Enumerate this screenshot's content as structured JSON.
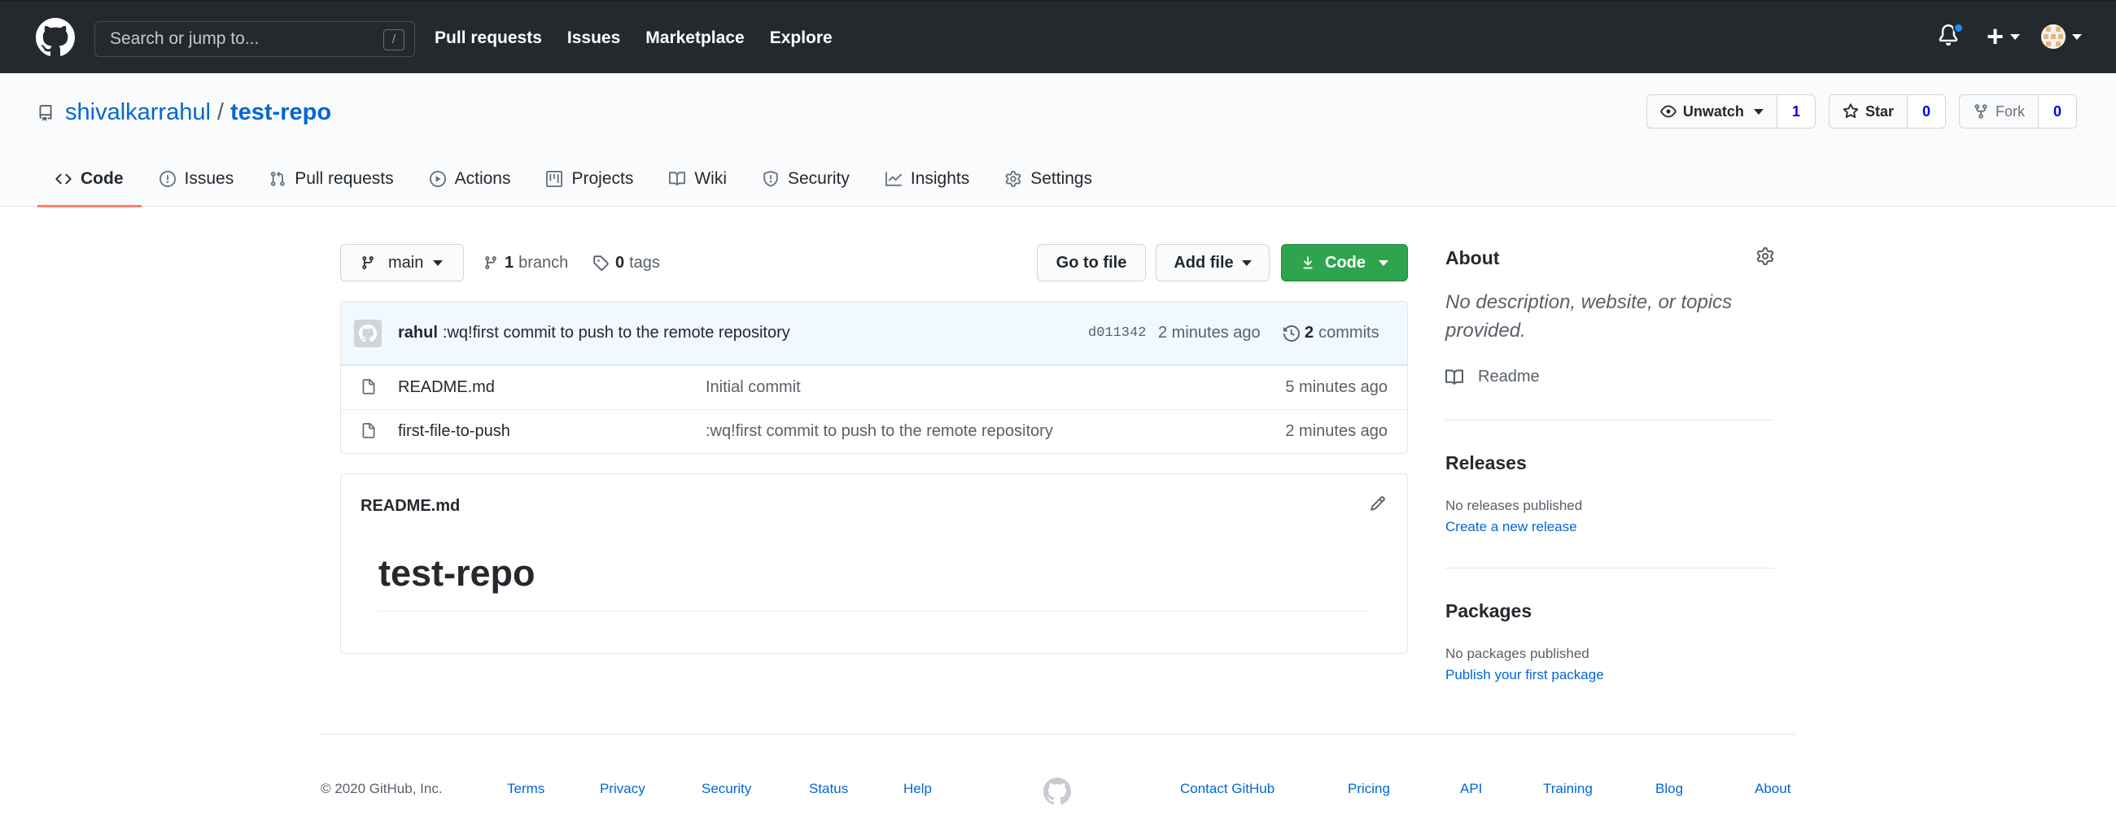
{
  "header": {
    "search_placeholder": "Search or jump to...",
    "search_shortcut": "/",
    "nav": [
      "Pull requests",
      "Issues",
      "Marketplace",
      "Explore"
    ],
    "plus_label": "+",
    "notification_dot_color": "#2188ff"
  },
  "repo": {
    "owner": "shivalkarrahul",
    "separator": "/",
    "name": "test-repo",
    "watch": {
      "label": "Unwatch",
      "count": "1"
    },
    "star": {
      "label": "Star",
      "count": "0"
    },
    "fork": {
      "label": "Fork",
      "count": "0"
    }
  },
  "tabs": [
    {
      "label": "Code",
      "icon": "code-icon",
      "selected": true
    },
    {
      "label": "Issues",
      "icon": "issue-opened-icon"
    },
    {
      "label": "Pull requests",
      "icon": "git-pull-request-icon"
    },
    {
      "label": "Actions",
      "icon": "play-icon"
    },
    {
      "label": "Projects",
      "icon": "project-icon"
    },
    {
      "label": "Wiki",
      "icon": "book-icon"
    },
    {
      "label": "Security",
      "icon": "shield-icon"
    },
    {
      "label": "Insights",
      "icon": "graph-icon"
    },
    {
      "label": "Settings",
      "icon": "gear-icon"
    }
  ],
  "filenav": {
    "branch": "main",
    "branch_count": "1",
    "branch_label": "branch",
    "tag_count": "0",
    "tag_label": "tags",
    "go_to_file": "Go to file",
    "add_file": "Add file",
    "code": "Code"
  },
  "commit": {
    "author": "rahul",
    "message": ":wq!first commit to push to the remote repository",
    "sha": "d011342",
    "time": "2 minutes ago",
    "count": "2",
    "count_label": "commits"
  },
  "files": [
    {
      "name": "README.md",
      "message": "Initial commit",
      "age": "5 minutes ago"
    },
    {
      "name": "first-file-to-push",
      "message": ":wq!first commit to push to the remote repository",
      "age": "2 minutes ago"
    }
  ],
  "readme": {
    "filename": "README.md",
    "heading": "test-repo"
  },
  "sidebar": {
    "about_title": "About",
    "about_desc": "No description, website, or topics provided.",
    "readme_link": "Readme",
    "releases_title": "Releases",
    "releases_text": "No releases published",
    "releases_link": "Create a new release",
    "packages_title": "Packages",
    "packages_text": "No packages published",
    "packages_link": "Publish your first package"
  },
  "footer": {
    "copyright": "© 2020 GitHub, Inc.",
    "left_links": [
      "Terms",
      "Privacy",
      "Security",
      "Status",
      "Help"
    ],
    "right_links": [
      "Contact GitHub",
      "Pricing",
      "API",
      "Training",
      "Blog",
      "About"
    ]
  },
  "colors": {
    "header_bg": "#24292e",
    "link": "#0366d6",
    "green_button": "#2ea44f",
    "tab_underline": "#f9826c"
  }
}
